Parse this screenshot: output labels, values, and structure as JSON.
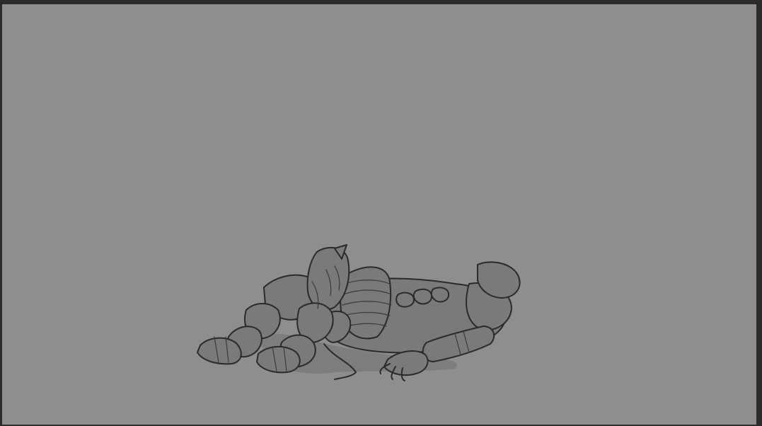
{
  "app": {
    "theme_colors": {
      "frame": "#2f2f2f",
      "canvas": "#8e8e8e",
      "lineart": "#2a2a2a",
      "fill": "#7a7a7a"
    }
  },
  "canvas": {
    "content": "lineart-drawing-armored-figure-lying-down"
  }
}
